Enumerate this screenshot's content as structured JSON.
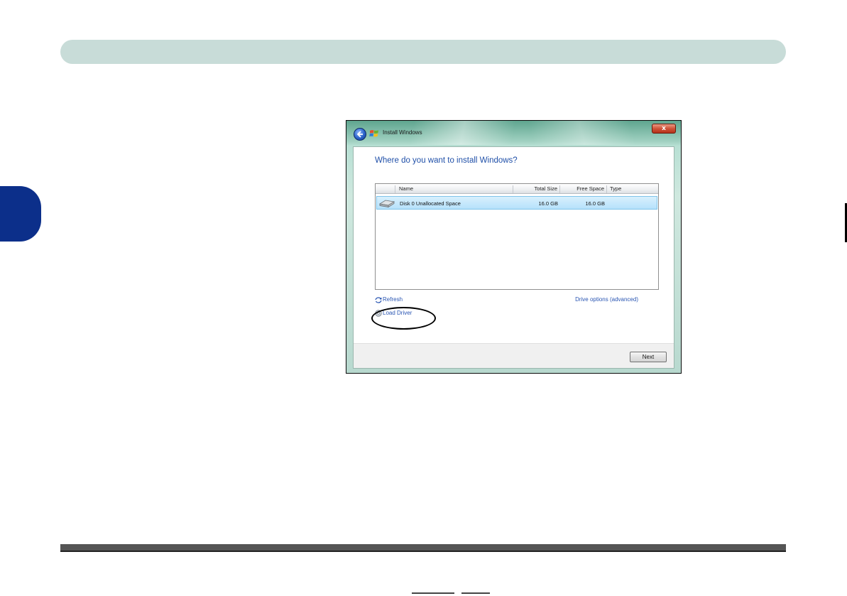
{
  "window": {
    "title": "Install Windows",
    "close_label": "x"
  },
  "prompt": "Where do you want to install Windows?",
  "table": {
    "columns": [
      "Name",
      "Total Size",
      "Free Space",
      "Type"
    ],
    "rows": [
      {
        "name": "Disk 0 Unallocated Space",
        "total_size": "16.0 GB",
        "free_space": "16.0 GB",
        "type": "",
        "selected": true
      }
    ]
  },
  "actions": {
    "refresh": "Refresh",
    "load_driver": "Load Driver",
    "drive_options": "Drive options (advanced)",
    "next": "Next"
  },
  "colors": {
    "header_bar": "#c8dcd8",
    "side_tab": "#0c2f8a",
    "prompt_text": "#1f4fa8",
    "link_text": "#2a56b3",
    "selected_row": "#b6e1fb"
  }
}
